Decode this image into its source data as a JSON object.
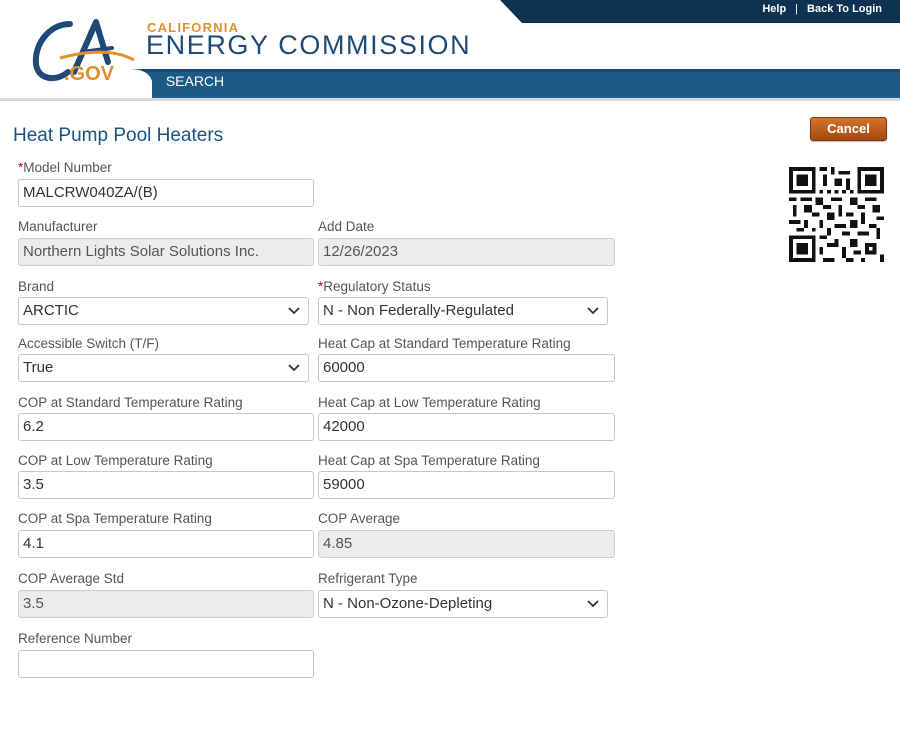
{
  "header": {
    "logo_text_ca": "CA",
    "logo_text_gov": ".GOV",
    "brand_small": "CALIFORNIA",
    "brand_big": "ENERGY COMMISSION",
    "top_links": {
      "help": "Help",
      "separator": "|",
      "back_to_login": "Back To Login"
    },
    "nav": {
      "search": "SEARCH"
    }
  },
  "page": {
    "title": "Heat Pump Pool Heaters",
    "cancel_label": "Cancel",
    "required_marker": "*"
  },
  "form": {
    "model_number": {
      "label": "Model Number",
      "value": "MALCRW040ZA/(B)"
    },
    "manufacturer": {
      "label": "Manufacturer",
      "value": "Northern Lights Solar Solutions Inc."
    },
    "add_date": {
      "label": "Add Date",
      "value": "12/26/2023"
    },
    "brand": {
      "label": "Brand",
      "value": "ARCTIC"
    },
    "regulatory_status": {
      "label": "Regulatory Status",
      "value": "N - Non Federally-Regulated"
    },
    "accessible_switch": {
      "label": "Accessible Switch (T/F)",
      "value": "True"
    },
    "heat_cap_standard": {
      "label": "Heat Cap at Standard Temperature Rating",
      "value": "60000"
    },
    "cop_standard": {
      "label": "COP at Standard Temperature Rating",
      "value": "6.2"
    },
    "heat_cap_low": {
      "label": "Heat Cap at Low Temperature Rating",
      "value": "42000"
    },
    "cop_low": {
      "label": "COP at Low Temperature Rating",
      "value": "3.5"
    },
    "heat_cap_spa": {
      "label": "Heat Cap at Spa Temperature Rating",
      "value": "59000"
    },
    "cop_spa": {
      "label": "COP at Spa Temperature Rating",
      "value": "4.1"
    },
    "cop_average": {
      "label": "COP Average",
      "value": "4.85"
    },
    "cop_average_std": {
      "label": "COP Average Std",
      "value": "3.5"
    },
    "refrigerant_type": {
      "label": "Refrigerant Type",
      "value": "N - Non-Ozone-Depleting"
    },
    "reference_number": {
      "label": "Reference Number",
      "value": ""
    }
  },
  "colors": {
    "navy": "#0e3251",
    "nav_blue": "#1d5b87",
    "title_blue": "#1c5282",
    "cancel_orange": "#b9561a",
    "logo_gold": "#e1902c"
  },
  "icons": {
    "chevron": "chevron-down-icon",
    "qr": "qr-code-icon"
  }
}
